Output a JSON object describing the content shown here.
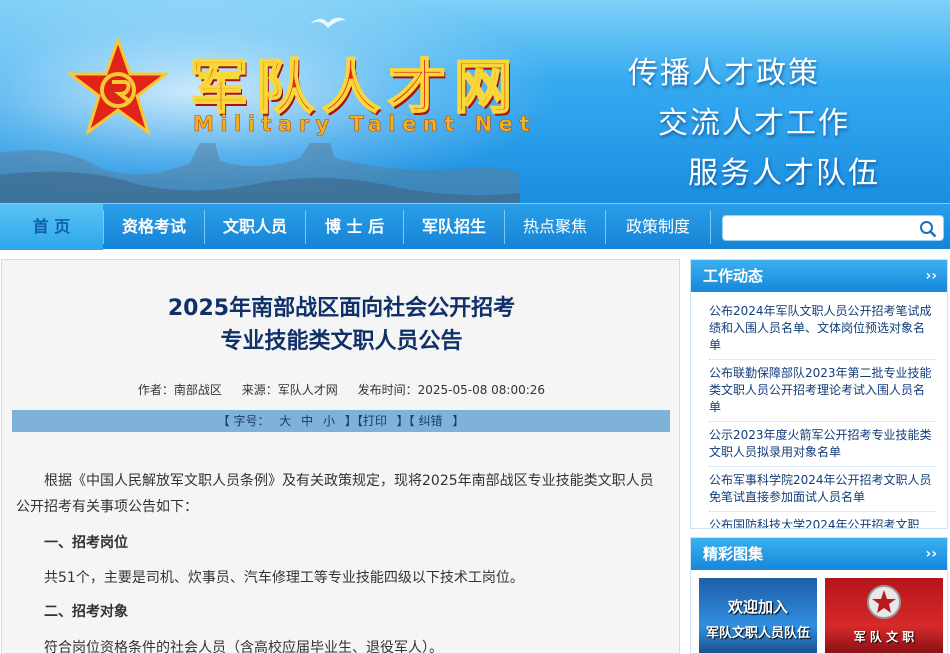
{
  "banner": {
    "title": "军队人才网",
    "subtitle": "Military Talent Net",
    "slogans": [
      "传播人才政策",
      "交流人才工作",
      "服务人才队伍"
    ]
  },
  "nav": {
    "items": [
      "首 页",
      "资格考试",
      "文职人员",
      "博 士 后",
      "军队招生",
      "热点聚焦",
      "政策制度"
    ]
  },
  "article": {
    "title_line1": "2025年南部战区面向社会公开招考",
    "title_line2": "专业技能类文职人员公告",
    "author": "作者：南部战区",
    "source": "来源：军队人才网",
    "time": "发布时间：2025-05-08 08:00:26",
    "toolbar": {
      "font_size": "【 字号：",
      "large": "大",
      "medium": "中",
      "small": "小",
      "print": "】【打印",
      "correct": "】【 纠错",
      "end": "】"
    },
    "para1": "根据《中国人民解放军文职人员条例》及有关政策规定，现将2025年南部战区专业技能类文职人员公开招考有关事项公告如下：",
    "sec1": "一、招考岗位",
    "sec1_text": "共51个，主要是司机、炊事员、汽车修理工等专业技能四级以下技术工岗位。",
    "sec2": "二、招考对象",
    "sec2_text": "符合岗位资格条件的社会人员（含高校应届毕业生、退役军人）。"
  },
  "sidebar": {
    "work_title": "工作动态",
    "more": "››",
    "news": [
      "公布2024年军队文职人员公开招考笔试成绩和入围人员名单、文体岗位预选对象名单",
      "公布联勤保障部队2023年第二批专业技能类文职人员公开招考理论考试入围人员名单",
      "公示2023年度火箭军公开招考专业技能类文职人员拟录用对象名单",
      "公布军事科学院2024年公开招考文职人员免笔试直接参加面试人员名单",
      "公布国防科技大学2024年公开招考文职"
    ],
    "gallery_title": "精彩图集",
    "thumb1_line1": "欢迎加入",
    "thumb1_line2": "军队文职人员队伍",
    "thumb2_line1": "军 队 文 职"
  }
}
